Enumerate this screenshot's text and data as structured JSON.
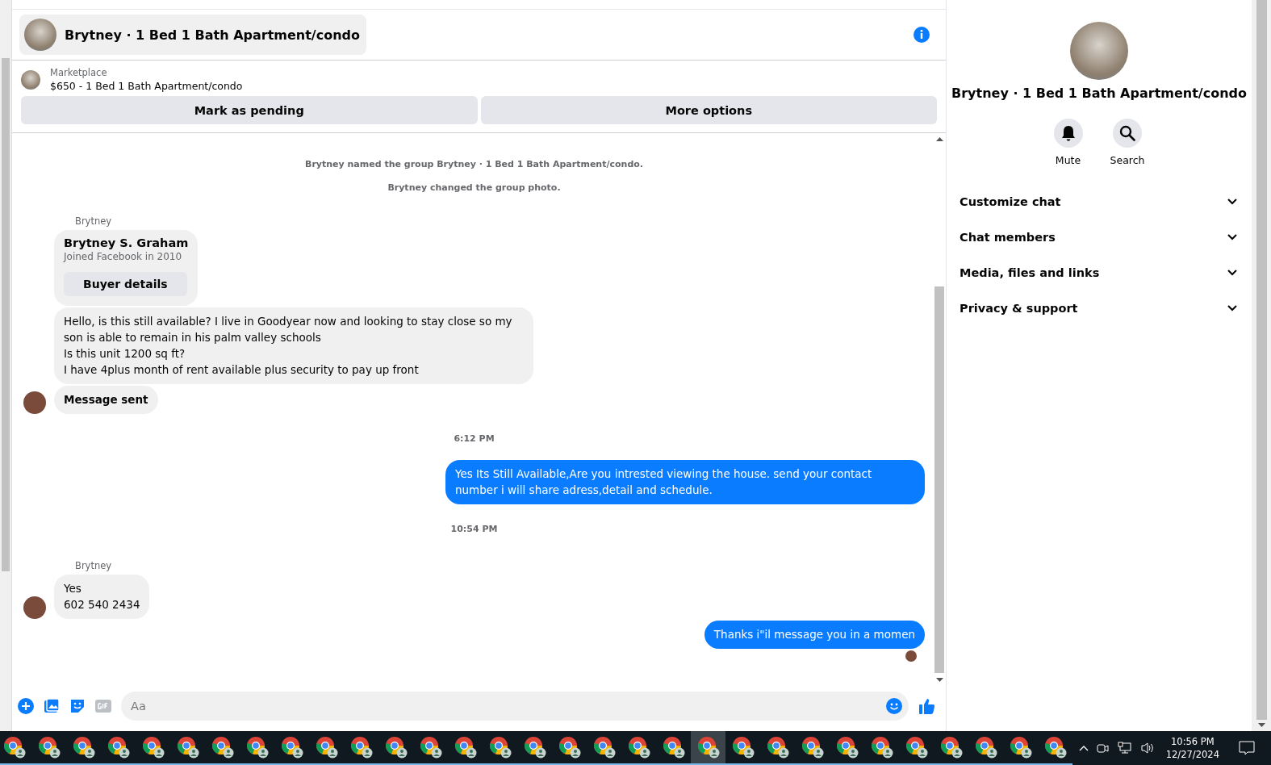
{
  "header": {
    "title": "Brytney · 1 Bed 1 Bath Apartment/condo"
  },
  "listing": {
    "source": "Marketplace",
    "title": "$650 - 1 Bed 1 Bath Apartment/condo",
    "buttons": [
      "Mark as pending",
      "More options"
    ]
  },
  "messages": [
    {
      "kind": "system",
      "text": "Brytney named the group Brytney · 1 Bed 1 Bath Apartment/condo."
    },
    {
      "kind": "system",
      "text": "Brytney changed the group photo."
    },
    {
      "kind": "sender",
      "text": "Brytney"
    },
    {
      "kind": "profile",
      "name": "Brytney S. Graham",
      "subtitle": "Joined Facebook in 2010",
      "button": "Buyer details"
    },
    {
      "kind": "incoming",
      "text": "Hello, is this still available? I live in Goodyear now and looking to stay close so my son is able to remain in his palm valley schools\nIs this unit 1200 sq ft?\nI have 4plus month of rent available plus security to pay up front",
      "avatar": false
    },
    {
      "kind": "notice",
      "text": "Message sent",
      "avatar": true
    },
    {
      "kind": "time",
      "text": "6:12 PM"
    },
    {
      "kind": "outgoing",
      "text": "Yes Its Still Available,Are you intrested viewing the house. send your contact number i will share adress,detail and schedule.",
      "seen": false
    },
    {
      "kind": "time",
      "text": "10:54 PM"
    },
    {
      "kind": "sender",
      "text": "Brytney"
    },
    {
      "kind": "incoming",
      "text": "Yes\n602 540 2434",
      "avatar": true
    },
    {
      "kind": "outgoing",
      "text": "Thanks i\"il message you in a momen",
      "seen": true
    }
  ],
  "composer": {
    "placeholder": "Aa"
  },
  "panel": {
    "title": "Brytney · 1 Bed 1 Bath Apartment/condo",
    "actions": [
      {
        "kind": "mute",
        "label": "Mute"
      },
      {
        "kind": "search",
        "label": "Search"
      }
    ],
    "sections": [
      {
        "label": "Customize chat",
        "expanded": false
      },
      {
        "label": "Chat members",
        "expanded": false
      },
      {
        "label": "Media, files and links",
        "expanded": false
      },
      {
        "label": "Privacy & support",
        "expanded": false
      }
    ]
  },
  "taskbar": {
    "apps": [
      {
        "selected": false
      },
      {
        "selected": false
      },
      {
        "selected": false
      },
      {
        "selected": false
      },
      {
        "selected": false
      },
      {
        "selected": false
      },
      {
        "selected": false
      },
      {
        "selected": false
      },
      {
        "selected": false
      },
      {
        "selected": false
      },
      {
        "selected": false
      },
      {
        "selected": false
      },
      {
        "selected": false
      },
      {
        "selected": false
      },
      {
        "selected": false
      },
      {
        "selected": false
      },
      {
        "selected": false
      },
      {
        "selected": false
      },
      {
        "selected": false
      },
      {
        "selected": false
      },
      {
        "selected": true
      },
      {
        "selected": false
      },
      {
        "selected": false
      },
      {
        "selected": false
      },
      {
        "selected": false
      },
      {
        "selected": false
      },
      {
        "selected": false
      },
      {
        "selected": false
      },
      {
        "selected": false
      },
      {
        "selected": false
      },
      {
        "selected": false
      }
    ],
    "time": "10:56 PM",
    "date": "12/27/2024"
  }
}
